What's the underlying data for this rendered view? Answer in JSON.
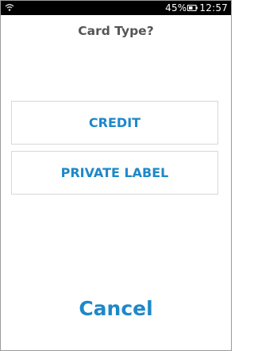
{
  "status_bar": {
    "battery": "45%",
    "time": "12:57",
    "icons": [
      "wifi-icon",
      "battery-icon"
    ]
  },
  "prompt": {
    "title": "Card Type?"
  },
  "options": [
    {
      "label": "CREDIT"
    },
    {
      "label": "PRIVATE LABEL"
    }
  ],
  "actions": {
    "cancel_label": "Cancel"
  },
  "colors": {
    "accent": "#1e88c8",
    "title_text": "#555555",
    "status_bar_bg": "#000000",
    "button_border": "#d8d8d8"
  }
}
